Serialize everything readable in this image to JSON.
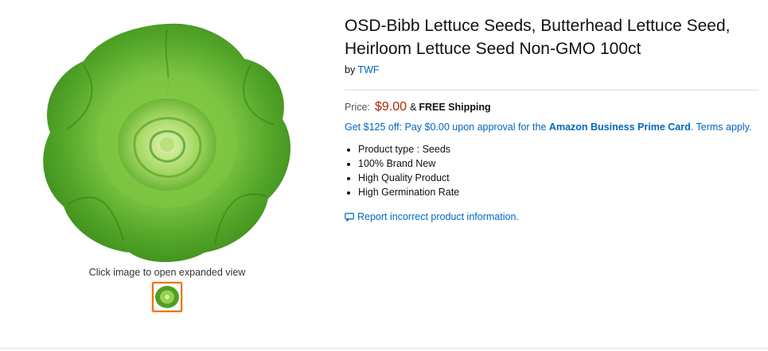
{
  "product": {
    "title": "OSD-Bibb Lettuce Seeds, Butterhead Lettuce Seed, Heirloom Lettuce Seed Non-GMO 100ct",
    "by_prefix": "by",
    "brand": "TWF",
    "price_label": "Price:",
    "price": "$9.00",
    "shipping_amp": "&",
    "shipping": "FREE Shipping",
    "promo_text": "Get $125 off: Pay $0.00 upon approval for the",
    "promo_card": "Amazon Business Prime Card",
    "promo_tail": ". Terms apply.",
    "features": [
      "Product type : Seeds",
      "100% Brand New",
      "High Quality Product",
      "High Germination Rate"
    ],
    "report_link": "Report incorrect product information.",
    "report_icon": "speech-bubble-icon"
  },
  "gallery": {
    "expand_hint": "Click image to open expanded view",
    "main_image": "butterhead-lettuce-image",
    "thumbnails": [
      "butterhead-lettuce-thumbnail"
    ]
  },
  "colors": {
    "link": "#0066c0",
    "price": "#b12704",
    "thumb_border": "#e77600",
    "lettuce_dark": "#3f8f1e",
    "lettuce_light": "#8fd14f"
  }
}
